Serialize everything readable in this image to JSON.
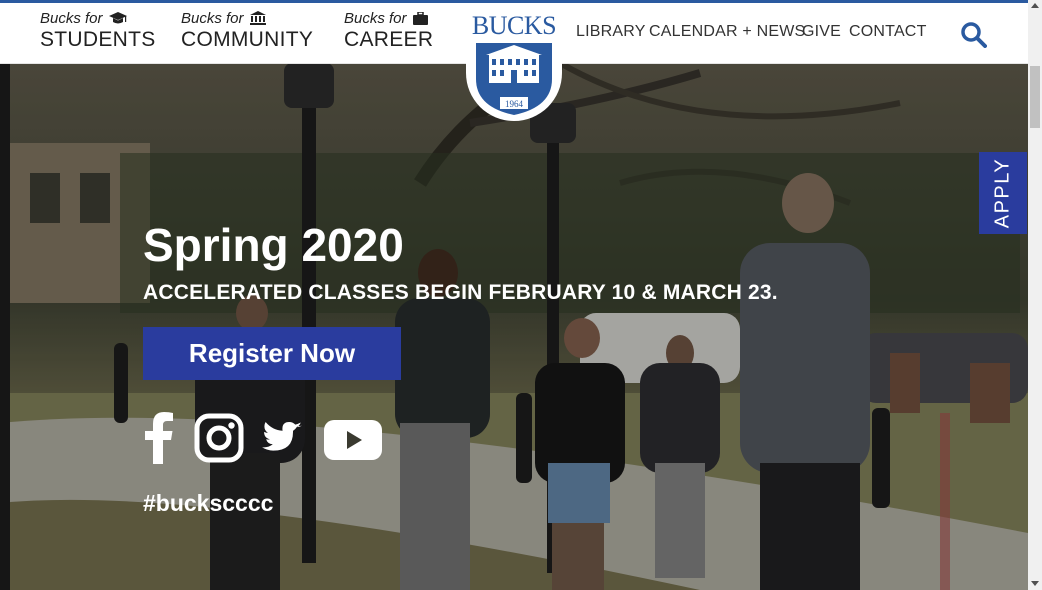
{
  "header": {
    "audiences": [
      {
        "prefix": "Bucks for",
        "label": "STUDENTS",
        "icon": "graduation-cap-icon"
      },
      {
        "prefix": "Bucks for",
        "label": "COMMUNITY",
        "icon": "institution-icon"
      },
      {
        "prefix": "Bucks for",
        "label": "CAREER",
        "icon": "briefcase-icon"
      }
    ],
    "logo": {
      "text": "BUCKS",
      "year": "1964"
    },
    "nav": [
      "LIBRARY",
      "CALENDAR + NEWS",
      "GIVE",
      "CONTACT"
    ],
    "search_icon": "search-icon"
  },
  "hero": {
    "headline": "Spring 2020",
    "subline": "ACCELERATED CLASSES BEGIN FEBRUARY 10 & MARCH 23.",
    "cta": "Register Now",
    "hashtag": "#buckscccc",
    "social": [
      "facebook-icon",
      "instagram-icon",
      "twitter-icon",
      "youtube-icon"
    ]
  },
  "apply_tab": "APPLY",
  "colors": {
    "brand_blue": "#2a3c9e",
    "logo_blue": "#2a5aa0",
    "text_dark": "#222222"
  }
}
